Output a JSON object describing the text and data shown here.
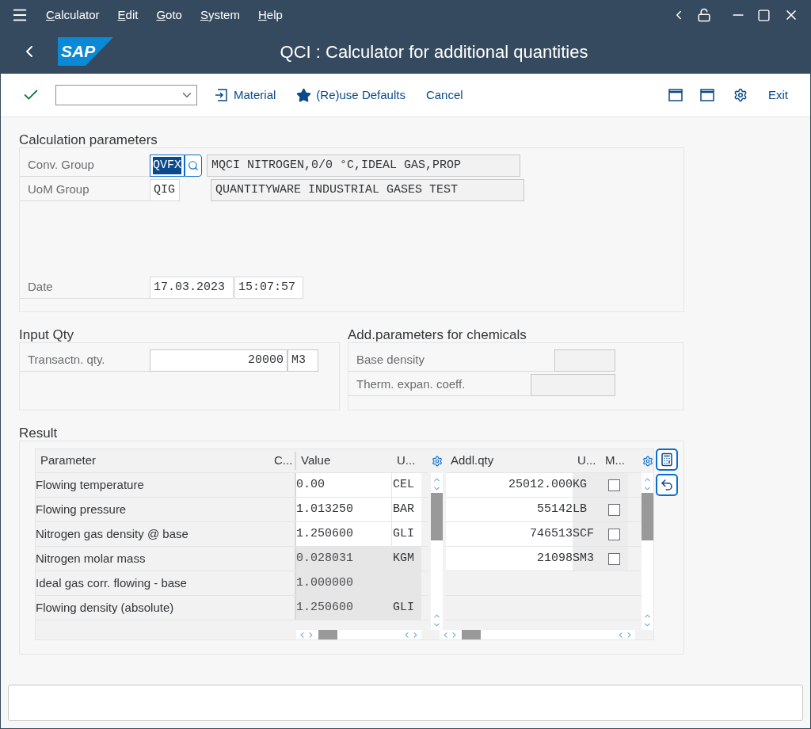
{
  "menu": [
    "Calculator",
    "Edit",
    "Goto",
    "System",
    "Help"
  ],
  "logo": "SAP",
  "title": "QCI : Calculator for additional quantities",
  "toolbar": {
    "buttons": [
      {
        "kind": "material",
        "label": "Material"
      },
      {
        "kind": "star",
        "label": "(Re)use Defaults"
      },
      {
        "kind": "plain",
        "label": "Cancel"
      }
    ],
    "exit": "Exit"
  },
  "calc_params": {
    "title": "Calculation parameters",
    "conv_group": {
      "label": "Conv. Group",
      "value": "QVFX",
      "selected": true,
      "description": "MQCI NITROGEN,0/0 °C,IDEAL GAS,PROP"
    },
    "uom_group": {
      "label": "UoM Group",
      "value": "QIG",
      "description": "QUANTITYWARE INDUSTRIAL GASES TEST"
    },
    "date": {
      "label": "Date",
      "value": "17.03.2023",
      "time": "15:07:57"
    }
  },
  "input_qty": {
    "title": "Input Qty",
    "label": "Transactn. qty.",
    "value": "20000",
    "unit": "M3"
  },
  "chem_params": {
    "title": "Add.parameters for chemicals",
    "fields": [
      {
        "label": "Base density"
      },
      {
        "label": "Therm. expan. coeff."
      }
    ]
  },
  "result": {
    "title": "Result",
    "left_columns": [
      "Parameter",
      "C...",
      "Value",
      "U..."
    ],
    "right_columns": [
      "Addl.qty",
      "U...",
      "M..."
    ],
    "rows": [
      {
        "parameter": "Flowing temperature",
        "value": "0.00",
        "unit": "CEL",
        "editable": true
      },
      {
        "parameter": "Flowing pressure",
        "value": "1.013250",
        "unit": "BAR",
        "editable": true
      },
      {
        "parameter": "Nitrogen gas density @ base",
        "value": "1.250600",
        "unit": "GLI",
        "editable": true
      },
      {
        "parameter": "Nitrogen molar mass",
        "value": "0.028031",
        "unit": "KGM",
        "editable": false
      },
      {
        "parameter": "Ideal gas corr. flowing - base",
        "value": "1.000000",
        "editable": false
      },
      {
        "parameter": "Flowing density (absolute)",
        "value": "1.250600",
        "unit": "GLI",
        "editable": false
      }
    ],
    "qty_rows": [
      {
        "qty": "25012.000",
        "unit": "KG",
        "checked": false
      },
      {
        "qty": "55142",
        "unit": "LB",
        "checked": false
      },
      {
        "qty": "746513",
        "unit": "SCF",
        "checked": false
      },
      {
        "qty": "21098",
        "unit": "SM3",
        "checked": false
      }
    ]
  }
}
